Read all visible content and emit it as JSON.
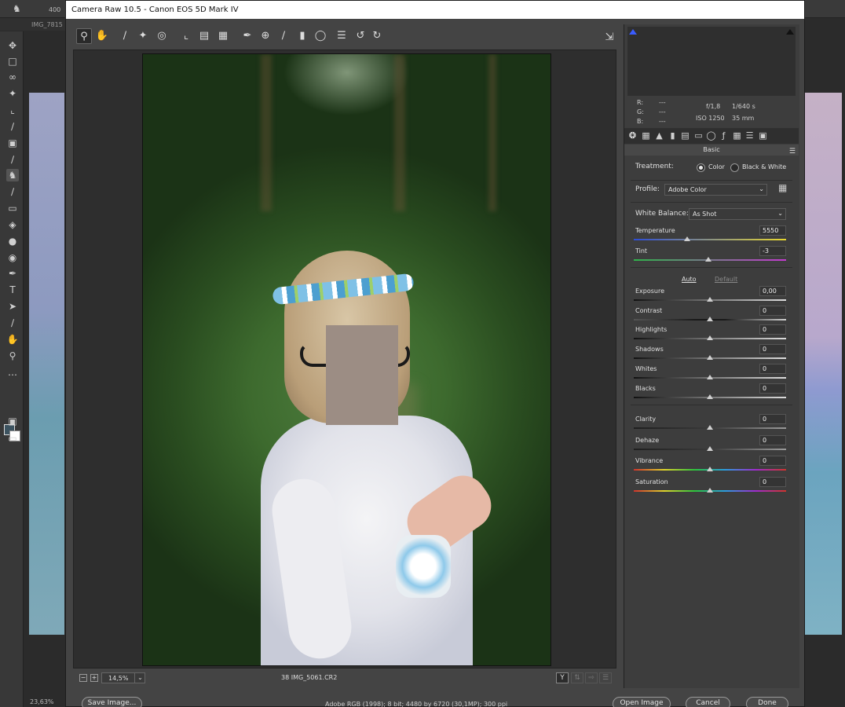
{
  "photoshop": {
    "brush_size": "400",
    "doc_tab": "IMG_7815",
    "zoom_status": "23,63%"
  },
  "dialog": {
    "title": "Camera Raw 10.5  -  Canon EOS 5D Mark IV",
    "toolbar_icons": [
      "zoom-tool-icon",
      "hand-tool-icon",
      "white-balance-tool-icon",
      "color-sampler-icon",
      "targeted-adjustment-icon",
      "crop-tool-icon",
      "straighten-tool-icon",
      "transform-tool-icon",
      "spot-removal-icon",
      "red-eye-removal-icon",
      "adjustment-brush-icon",
      "graduated-filter-icon",
      "radial-filter-icon",
      "preferences-icon",
      "rotate-left-icon",
      "rotate-right-icon"
    ],
    "zoom_value": "14,5%",
    "filename": "38 IMG_5061.CR2",
    "workflow": "Adobe RGB (1998); 8 bit; 4480 by 6720 (30,1MP); 300 ppi",
    "buttons": {
      "save": "Save Image...",
      "open": "Open Image",
      "cancel": "Cancel",
      "done": "Done"
    }
  },
  "panel": {
    "readout": {
      "r_label": "R:",
      "g_label": "G:",
      "b_label": "B:",
      "r": "---",
      "g": "---",
      "b": "---",
      "aperture": "f/1,8",
      "shutter": "1/640 s",
      "iso": "ISO 1250",
      "focal": "35 mm"
    },
    "section_title": "Basic",
    "treatment": {
      "label": "Treatment:",
      "color": "Color",
      "bw": "Black & White",
      "selected": "Color"
    },
    "profile": {
      "label": "Profile:",
      "value": "Adobe Color"
    },
    "white_balance": {
      "label": "White Balance:",
      "value": "As Shot"
    },
    "temperature": {
      "label": "Temperature",
      "value": "5550",
      "slider_fraction": 0.35
    },
    "tint": {
      "label": "Tint",
      "value": "-3",
      "slider_fraction": 0.49
    },
    "auto": "Auto",
    "default": "Default",
    "tone": [
      {
        "label": "Exposure",
        "value": "0,00",
        "slider_fraction": 0.5
      },
      {
        "label": "Contrast",
        "value": "0",
        "slider_fraction": 0.5
      },
      {
        "label": "Highlights",
        "value": "0",
        "slider_fraction": 0.5
      },
      {
        "label": "Shadows",
        "value": "0",
        "slider_fraction": 0.5
      },
      {
        "label": "Whites",
        "value": "0",
        "slider_fraction": 0.5
      },
      {
        "label": "Blacks",
        "value": "0",
        "slider_fraction": 0.5
      }
    ],
    "presence": [
      {
        "label": "Clarity",
        "value": "0",
        "slider_fraction": 0.5
      },
      {
        "label": "Dehaze",
        "value": "0",
        "slider_fraction": 0.5
      },
      {
        "label": "Vibrance",
        "value": "0",
        "slider_fraction": 0.5
      },
      {
        "label": "Saturation",
        "value": "0",
        "slider_fraction": 0.5
      }
    ]
  },
  "colors": {
    "temperature_track": [
      "#2d4dd6",
      "#e8d830"
    ],
    "tint_track": [
      "#2fb34a",
      "#c43bd0"
    ],
    "saturation_track": [
      "#d0342c",
      "#e0d42c",
      "#2cc43c",
      "#2c9ce0",
      "#a02cd0",
      "#d0342c"
    ]
  }
}
